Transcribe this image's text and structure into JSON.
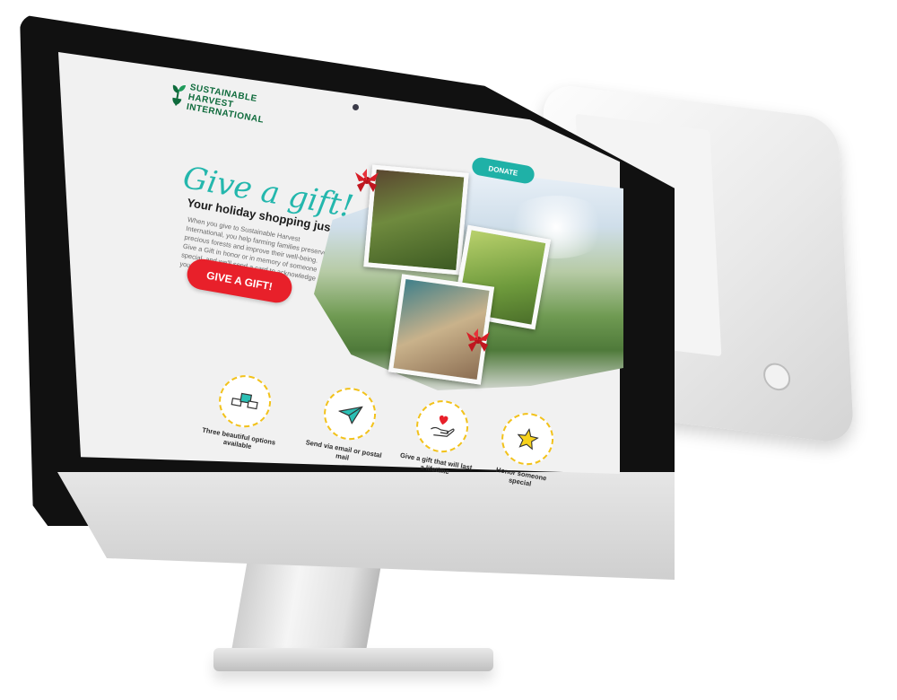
{
  "brand": {
    "logo_line1": "SUSTAINABLE",
    "logo_line2": "HARVEST",
    "logo_line3": "INTERNATIONAL"
  },
  "nav": {
    "donate_label": "DONATE"
  },
  "hero": {
    "title": "Give a gift!",
    "subtitle": "Your holiday shopping just got easier.",
    "body": "When you give to Sustainable Harvest International, you help farming families preserve precious forests and improve their well-being. Give a Gift in honor or in memory of someone special, and we'll send a card to acknowledge your gift!",
    "cta_label": "GIVE A GIFT!"
  },
  "features": [
    {
      "label": "Three beautiful options available",
      "icon": "cards-icon"
    },
    {
      "label": "Send via email or postal mail",
      "icon": "paper-plane-icon"
    },
    {
      "label": "Give a gift that will last a lifetime",
      "icon": "hand-heart-icon"
    },
    {
      "label": "Honor someone special",
      "icon": "star-icon"
    }
  ],
  "colors": {
    "accent_teal": "#24b7ad",
    "cta_red": "#e8202a",
    "brand_green": "#0f6b3c",
    "icon_ring_yellow": "#f2c21b"
  }
}
